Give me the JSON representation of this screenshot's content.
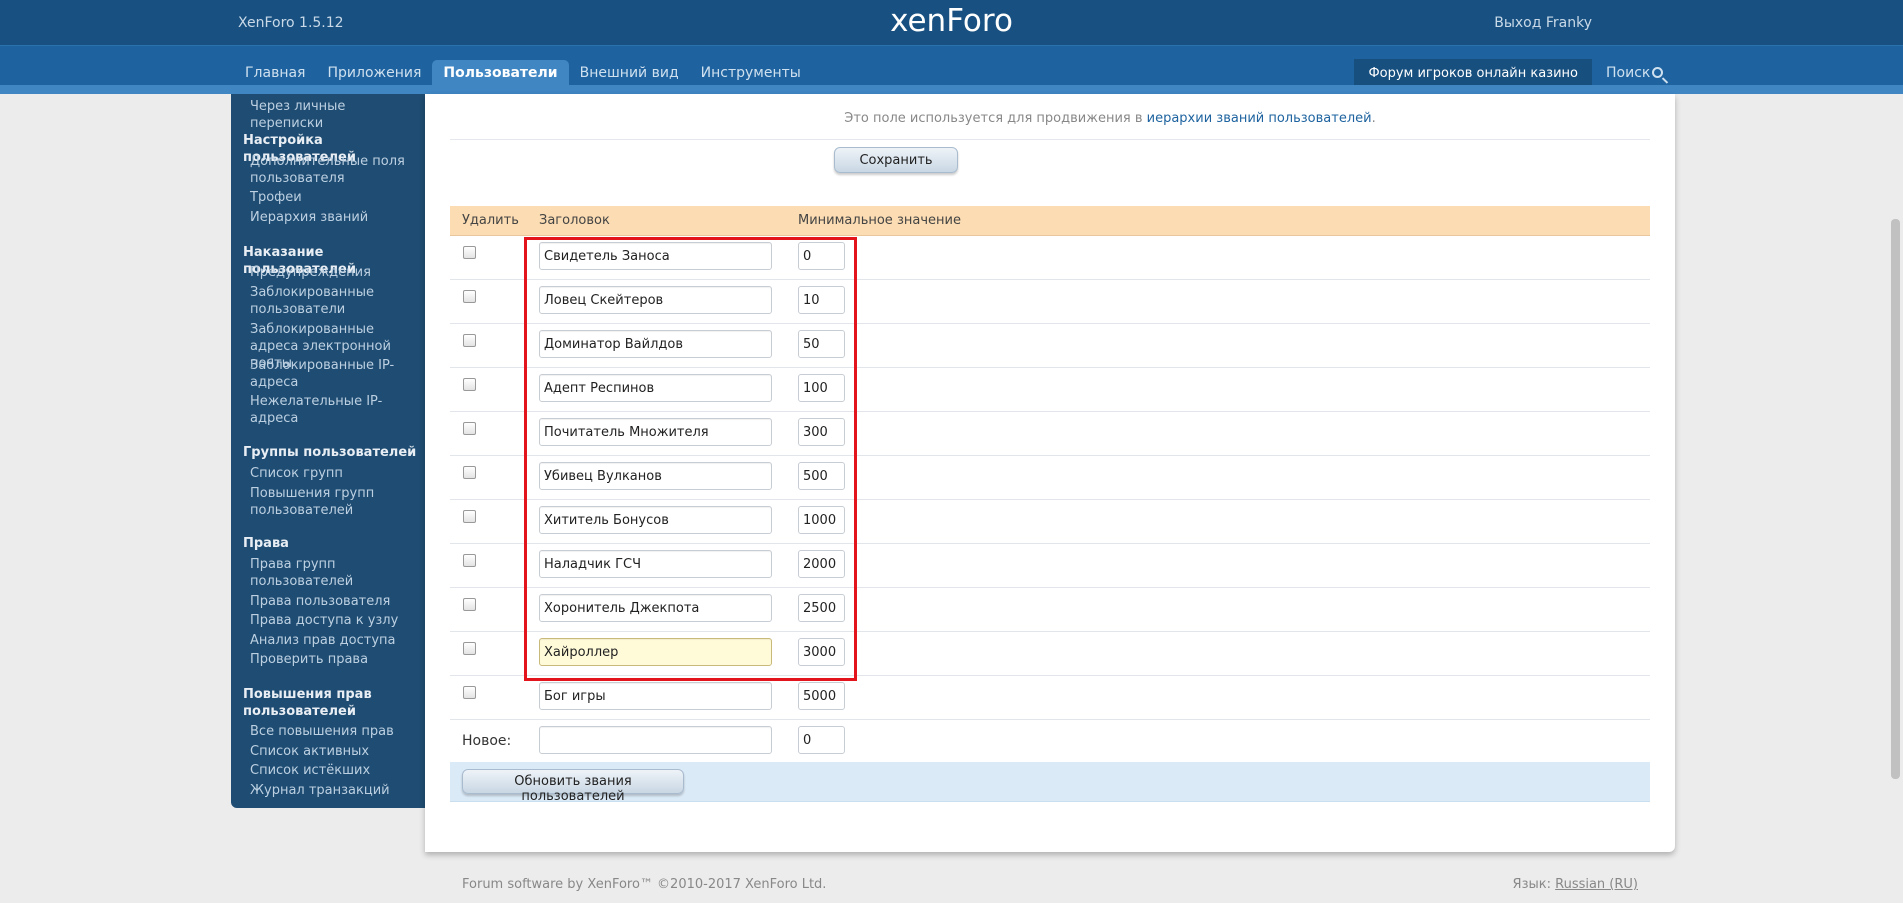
{
  "header": {
    "version": "XenForo 1.5.12",
    "logo": "xenForo",
    "logout": "Выход Franky"
  },
  "nav": {
    "tabs": [
      "Главная",
      "Приложения",
      "Пользователи",
      "Внешний вид",
      "Инструменты"
    ],
    "active_tab": "Пользователи",
    "forum_title": "Форум игроков онлайн казино",
    "search": "Поиск"
  },
  "sidebar": {
    "top_link": "Через личные переписки",
    "sections": [
      {
        "title": "Настройка пользователей",
        "links": [
          "Дополнительные поля пользователя",
          "Трофеи",
          "Иерархия званий"
        ]
      },
      {
        "title": "Наказание пользователей",
        "links": [
          "Предупреждения",
          "Заблокированные пользователи",
          "Заблокированные адреса электронной почты",
          "Заблокированные IP-адреса",
          "Нежелательные IP-адреса"
        ]
      },
      {
        "title": "Группы пользователей",
        "links": [
          "Список групп",
          "Повышения групп пользователей"
        ]
      },
      {
        "title": "Права",
        "links": [
          "Права групп пользователей",
          "Права пользователя",
          "Права доступа к узлу",
          "Анализ прав доступа",
          "Проверить права"
        ]
      },
      {
        "title": "Повышения прав пользователей",
        "links": [
          "Все повышения прав",
          "Список активных",
          "Список истёкших",
          "Журнал транзакций"
        ]
      }
    ]
  },
  "content": {
    "hint_prefix": "Это поле используется для продвижения в ",
    "hint_link": "иерархии званий пользователей",
    "hint_suffix": ".",
    "save_button": "Сохранить",
    "table": {
      "col_delete": "Удалить",
      "col_title": "Заголовок",
      "col_min": "Минимальное значение",
      "rows": [
        {
          "title": "Свидетель Заноса",
          "min": "0"
        },
        {
          "title": "Ловец Скейтеров",
          "min": "10"
        },
        {
          "title": "Доминатор Вайлдов",
          "min": "50"
        },
        {
          "title": "Адепт Респинов",
          "min": "100"
        },
        {
          "title": "Почитатель Множителя",
          "min": "300"
        },
        {
          "title": "Убивец Вулканов",
          "min": "500"
        },
        {
          "title": "Хититель Бонусов",
          "min": "1000"
        },
        {
          "title": "Наладчик ГСЧ",
          "min": "2000"
        },
        {
          "title": "Хоронитель Джекпота",
          "min": "2500"
        },
        {
          "title": "Хайроллер",
          "min": "3000"
        },
        {
          "title": "Бог игры",
          "min": "5000"
        }
      ],
      "new_label": "Новое:",
      "new_title": "",
      "new_min": "0"
    },
    "update_button": "Обновить звания пользователей"
  },
  "footer": {
    "copyright": "Forum software by XenForo™ ©2010-2017 XenForo Ltd.",
    "language_label": "Язык:",
    "language": "Russian (RU)"
  },
  "colors": {
    "header": "#185181",
    "nav": "#1e639f",
    "sidebar": "#1f4c72",
    "table_head": "#fbdcb3",
    "highlight_box": "#e3141b"
  }
}
